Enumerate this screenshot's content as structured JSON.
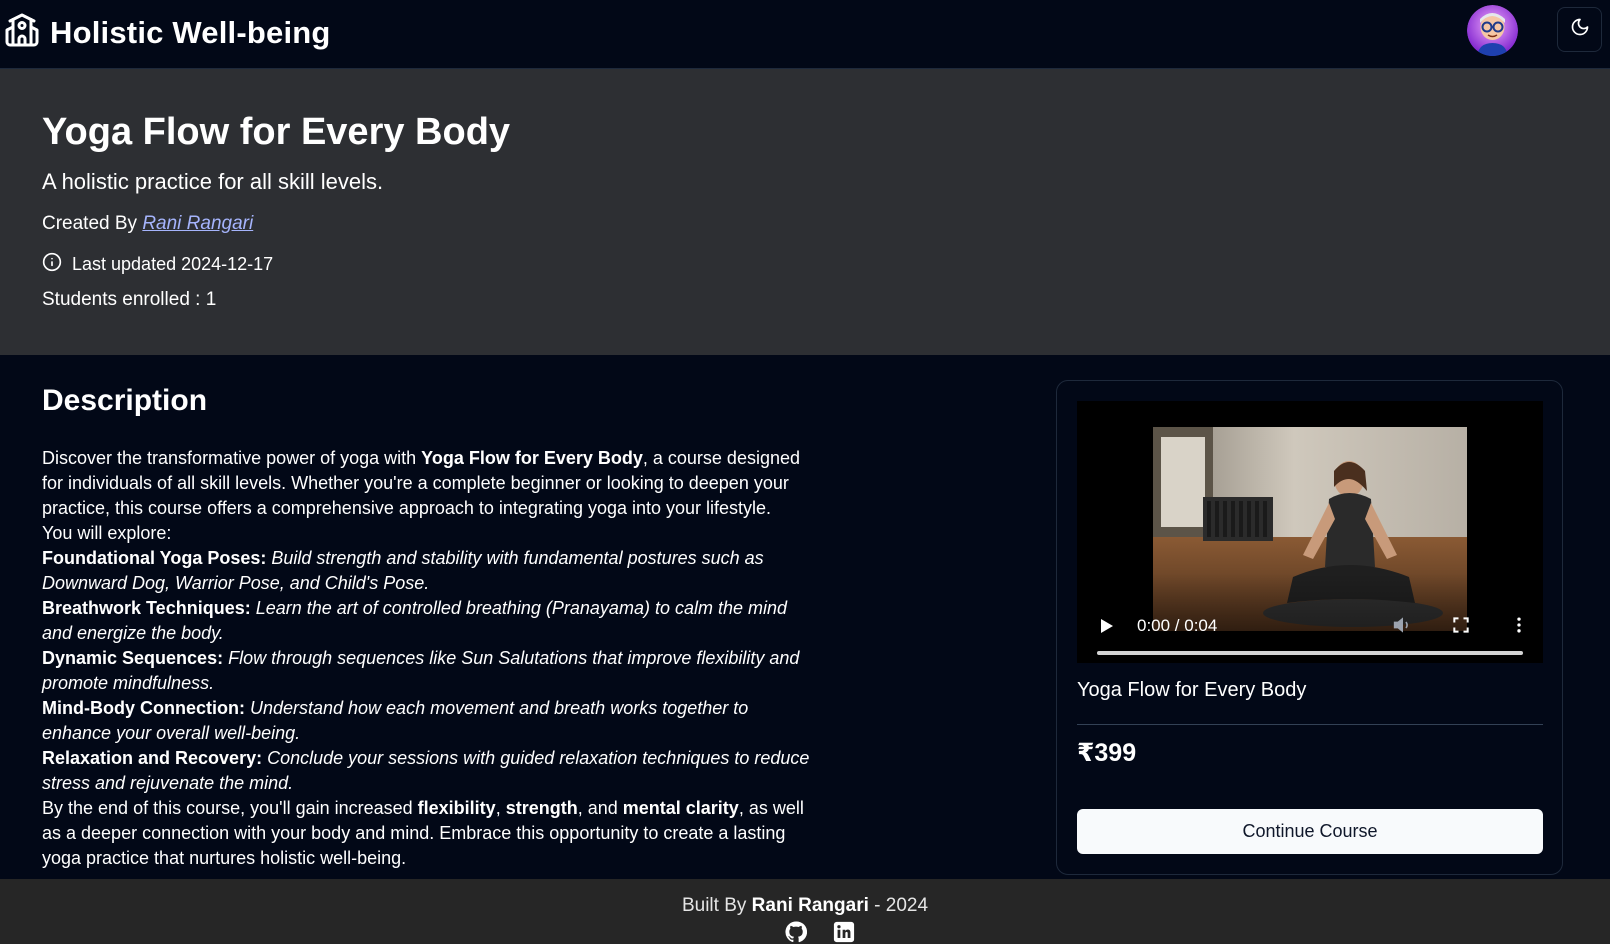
{
  "navbar": {
    "brand_title": "Holistic Well-being",
    "brand_icon": "school-building-icon",
    "avatar_icon": "user-avatar",
    "theme_icon": "moon-icon"
  },
  "hero": {
    "title": "Yoga Flow for Every Body",
    "subtitle": "A holistic practice for all skill levels.",
    "created_prefix": "Created By",
    "creator_name": "Rani Rangari",
    "last_updated_label": "Last updated 2024-12-17",
    "students_enrolled": "Students enrolled : 1"
  },
  "description": {
    "heading": "Description",
    "intro_1": "Discover the transformative power of yoga with ",
    "intro_bold": "Yoga Flow for Every Body",
    "intro_2": ", a course designed for individuals of all skill levels. Whether you're a complete beginner or looking to deepen your practice, this course offers a comprehensive approach to integrating yoga into your lifestyle.",
    "explore": "You will explore:",
    "items": [
      {
        "title": "Foundational Yoga Poses:",
        "text": " Build strength and stability with fundamental postures such as Downward Dog, Warrior Pose, and Child's Pose."
      },
      {
        "title": "Breathwork Techniques:",
        "text": " Learn the art of controlled breathing (Pranayama) to calm the mind and energize the body."
      },
      {
        "title": "Dynamic Sequences:",
        "text": " Flow through sequences like Sun Salutations that improve flexibility and promote mindfulness."
      },
      {
        "title": "Mind-Body Connection:",
        "text": " Understand how each movement and breath works together to enhance your overall well-being."
      },
      {
        "title": "Relaxation and Recovery:",
        "text": " Conclude your sessions with guided relaxation techniques to reduce stress and rejuvenate the mind."
      }
    ],
    "outro_1": "By the end of this course, you'll gain increased ",
    "outro_b1": "flexibility",
    "outro_2": ", ",
    "outro_b2": "strength",
    "outro_3": ", and ",
    "outro_b3": "mental clarity",
    "outro_4": ", as well as a deeper connection with your body and mind. Embrace this opportunity to create a lasting yoga practice that nurtures holistic well-being."
  },
  "card": {
    "video_time": "0:00 / 0:04",
    "video_progress": 0,
    "course_name": "Yoga Flow for Every Body",
    "price": "₹399",
    "button_label": "Continue Course"
  },
  "footer": {
    "built_by_prefix": "Built By ",
    "author": "Rani Rangari",
    "year_suffix": " - 2024",
    "icons": [
      "github-icon",
      "linkedin-icon"
    ]
  },
  "colors": {
    "page_bg": "#020817",
    "hero_bg": "#2d2f33",
    "footer_bg": "#262626",
    "link": "#a5b4fc"
  }
}
